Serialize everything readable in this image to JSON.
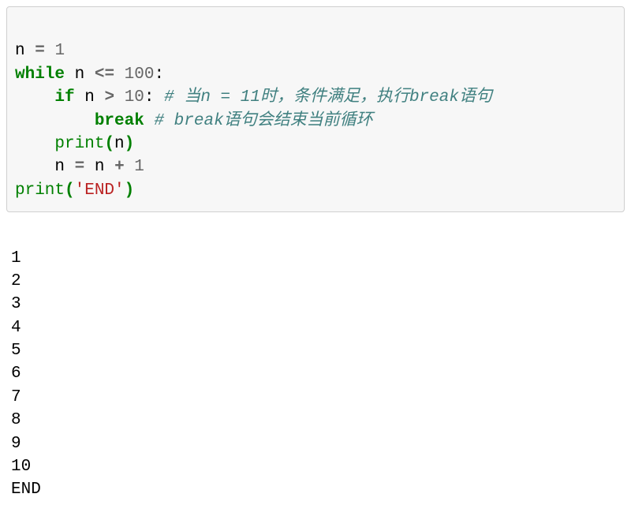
{
  "code": {
    "line1": {
      "var": "n",
      "eq": "=",
      "val": "1"
    },
    "line2": {
      "kw": "while",
      "var": "n",
      "op": "<=",
      "val": "100",
      "colon": ":"
    },
    "line3": {
      "kw": "if",
      "var": "n",
      "op": ">",
      "val": "10",
      "colon": ":",
      "cmt": "# 当n = 11时，条件满足，执行break语句"
    },
    "line4": {
      "kw": "break",
      "cmt": "# break语句会结束当前循环"
    },
    "line5": {
      "fn": "print",
      "lp": "(",
      "arg": "n",
      "rp": ")"
    },
    "line6": {
      "var": "n",
      "eq": "=",
      "var2": "n",
      "op": "+",
      "val": "1"
    },
    "line7": {
      "fn": "print",
      "lp": "(",
      "str": "'END'",
      "rp": ")"
    }
  },
  "output_lines": [
    "1",
    "2",
    "3",
    "4",
    "5",
    "6",
    "7",
    "8",
    "9",
    "10",
    "END"
  ]
}
